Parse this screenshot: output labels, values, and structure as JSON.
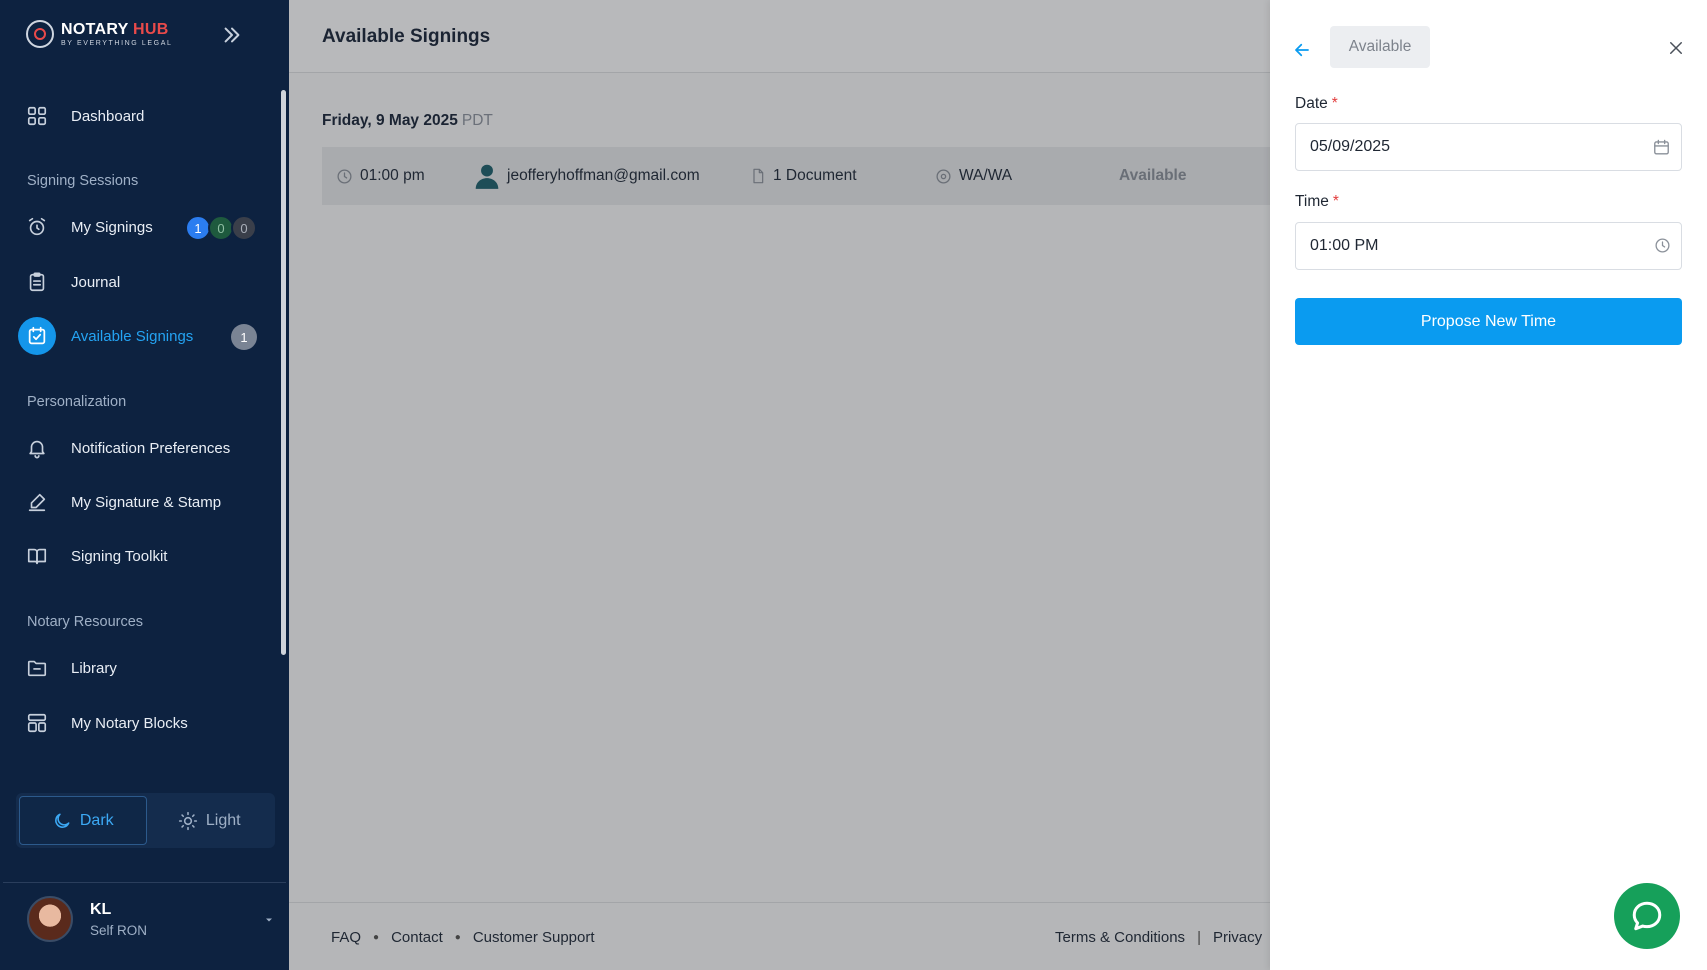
{
  "brand": {
    "title_main": "NOTARY",
    "title_accent": "HUB",
    "subtitle": "BY EVERYTHING LEGAL"
  },
  "sidebar": {
    "dashboard": "Dashboard",
    "section_signing": "Signing Sessions",
    "my_signings": "My Signings",
    "my_signings_badges": [
      "1",
      "0",
      "0"
    ],
    "journal": "Journal",
    "available_signings": "Available Signings",
    "available_signings_badge": "1",
    "section_personalization": "Personalization",
    "notification_preferences": "Notification Preferences",
    "signature_stamp": "My Signature & Stamp",
    "signing_toolkit": "Signing Toolkit",
    "section_resources": "Notary Resources",
    "library": "Library",
    "notary_blocks": "My Notary Blocks",
    "theme_dark": "Dark",
    "theme_light": "Light",
    "user_name": "KL",
    "user_role": "Self RON"
  },
  "main": {
    "title": "Available Signings",
    "date": "Friday, 9 May 2025",
    "timezone": "PDT",
    "row": {
      "time": "01:00 pm",
      "email": "jeofferyhoffman@gmail.com",
      "documents": "1 Document",
      "location": "WA/WA",
      "status": "Available"
    }
  },
  "footer": {
    "faq": "FAQ",
    "contact": "Contact",
    "support": "Customer Support",
    "terms": "Terms & Conditions",
    "privacy": "Privacy"
  },
  "drawer": {
    "status": "Available",
    "date_label": "Date",
    "date_value": "05/09/2025",
    "time_label": "Time",
    "time_value": "01:00 PM",
    "required_mark": "*",
    "submit": "Propose New Time"
  },
  "colors": {
    "sidebar_bg": "#0d2240",
    "accent": "#0a9bf0",
    "chat": "#16a05a",
    "required": "#e23b3b"
  }
}
